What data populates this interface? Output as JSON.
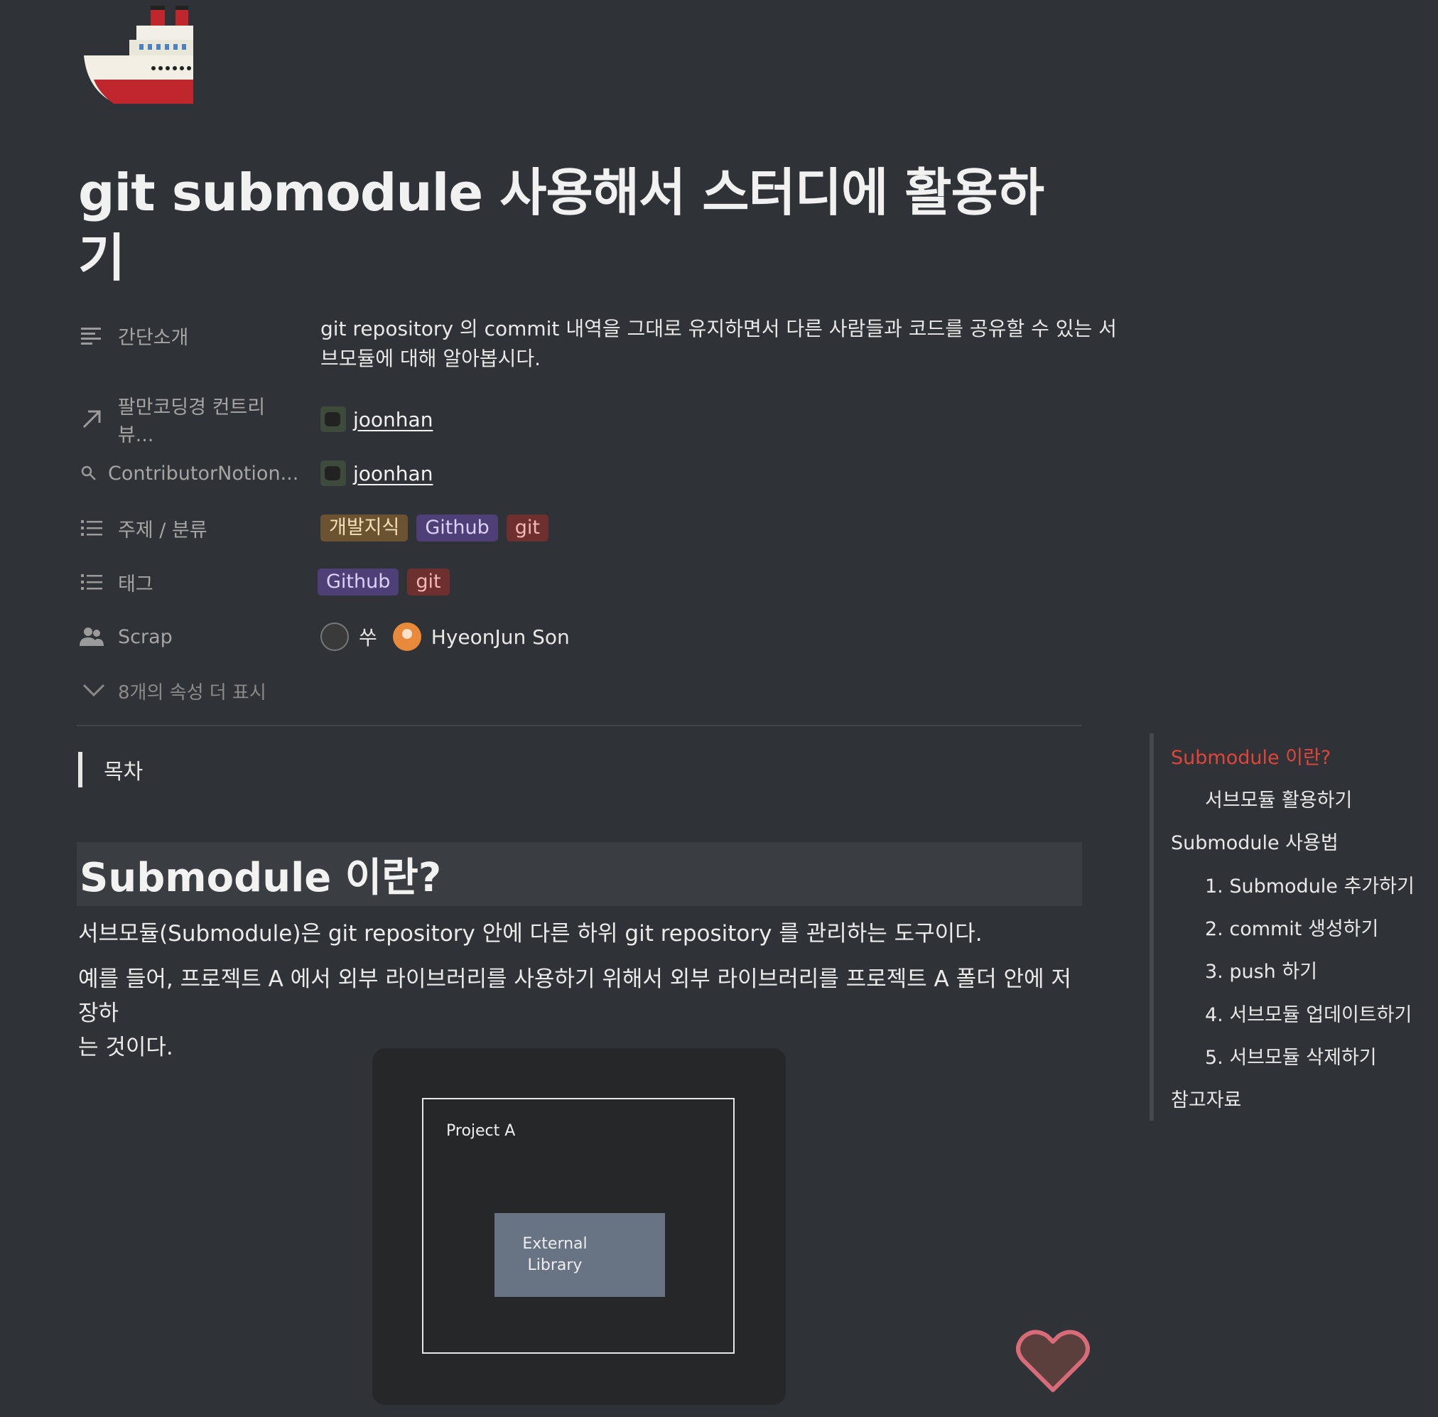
{
  "page": {
    "title_line1": "git submodule 사용해서 스터디에 활용하",
    "title_line2": "기",
    "icon": "ship-icon"
  },
  "properties": [
    {
      "name": "간단소개",
      "icon": "text-icon",
      "value_line1": "git repository 의 commit 내역을 그대로 유지하면서 다른 사람들과 코드를 공유할 수 있는 서",
      "value_line2": "브모듈에 대해 알아봅시다."
    },
    {
      "name": "팔만코딩경 컨트리뷰...",
      "icon": "arrow-up-right-icon",
      "value": "joonhan"
    },
    {
      "name": "ContributorNotion...",
      "icon": "search-icon",
      "value": "joonhan"
    },
    {
      "name": "주제 / 분류",
      "icon": "list-icon",
      "tags": [
        "개발지식",
        "Github",
        "git"
      ]
    },
    {
      "name": "태그",
      "icon": "list-icon",
      "tags": [
        "Github",
        "git"
      ]
    },
    {
      "name": "Scrap",
      "icon": "people-icon",
      "people": [
        "쑤",
        "HyeonJun Son"
      ]
    }
  ],
  "more_properties": "8개의 속성 더 표시",
  "toc_callout": "목차",
  "section": {
    "heading": "Submodule 이란?",
    "para1": "서브모듈(Submodule)은 git repository 안에 다른 하위 git repository 를 관리하는 도구이다.",
    "para2_line1": "예를 들어, 프로젝트 A 에서 외부 라이브러리를 사용하기 위해서 외부 라이브러리를 프로젝트 A 폴더 안에 저장하",
    "para2_line2": "는 것이다."
  },
  "figure": {
    "outer_label": "Project A",
    "inner_label_line1": "External",
    "inner_label_line2": "Library"
  },
  "toc": [
    {
      "label": "Submodule 이란?",
      "level": 0,
      "active": true
    },
    {
      "label": "서브모듈 활용하기",
      "level": 1
    },
    {
      "label": "Submodule 사용법",
      "level": 0
    },
    {
      "label": "1. Submodule 추가하기",
      "level": 1
    },
    {
      "label": "2. commit 생성하기",
      "level": 1
    },
    {
      "label": "3. push 하기",
      "level": 1
    },
    {
      "label": "4. 서브모듈 업데이트하기",
      "level": 1
    },
    {
      "label": "5. 서브모듈 삭제하기",
      "level": 1
    },
    {
      "label": "참고자료",
      "level": 0
    }
  ],
  "colors": {
    "background": "#2f3236",
    "toc_active": "#e0453a",
    "heart": "#d76b78"
  }
}
